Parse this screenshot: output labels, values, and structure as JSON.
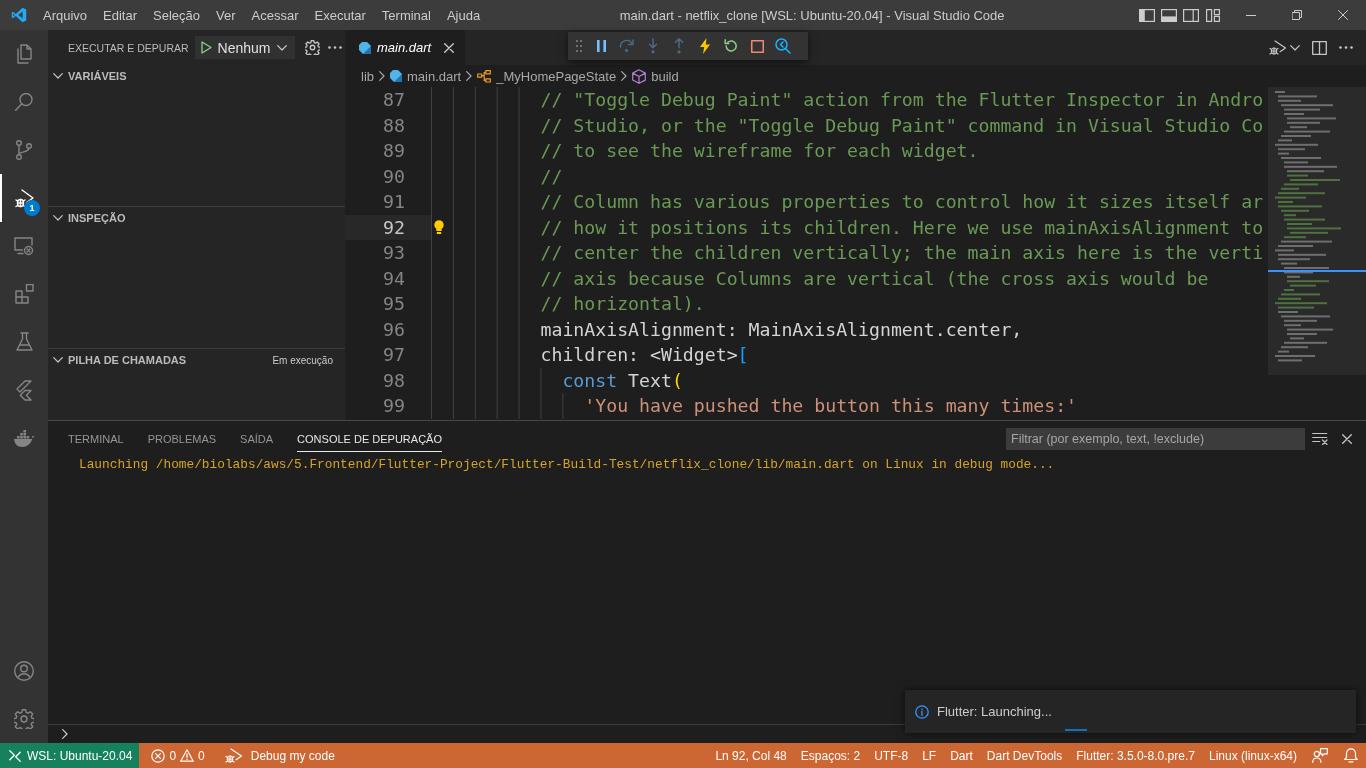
{
  "title_bar": {
    "menu": [
      "Arquivo",
      "Editar",
      "Seleção",
      "Ver",
      "Acessar",
      "Executar",
      "Terminal",
      "Ajuda"
    ],
    "title": "main.dart - netflix_clone [WSL: Ubuntu-20.04] - Visual Studio Code",
    "layout_toggles": [
      {
        "kind": "sidebar",
        "on": true
      },
      {
        "kind": "panel",
        "on": true
      },
      {
        "kind": "auxiliary",
        "on": false
      }
    ]
  },
  "activity_bar": {
    "items": [
      {
        "kind": "explorer",
        "selected": false
      },
      {
        "kind": "search",
        "selected": false
      },
      {
        "kind": "scm",
        "selected": false
      },
      {
        "kind": "debug",
        "selected": true,
        "badge": "1"
      },
      {
        "kind": "remote",
        "selected": false
      },
      {
        "kind": "extensions",
        "selected": false
      },
      {
        "kind": "testing",
        "selected": false
      },
      {
        "kind": "flutter",
        "selected": false
      },
      {
        "kind": "docker",
        "selected": false
      }
    ],
    "bottom": [
      {
        "kind": "accounts"
      },
      {
        "kind": "manage"
      }
    ]
  },
  "sidebar": {
    "title": "EXECUTAR E DEPURAR",
    "launch_config": "Nenhum",
    "sections": [
      {
        "title": "VARIÁVEIS",
        "expanded": true
      },
      {
        "title": "INSPEÇÃO",
        "expanded": true
      },
      {
        "title": "PILHA DE CHAMADAS",
        "expanded": true,
        "status": "Em execução"
      }
    ]
  },
  "debug_toolbar": [
    {
      "kind": "pause",
      "disabled": false
    },
    {
      "kind": "stepover",
      "disabled": true
    },
    {
      "kind": "stepinto",
      "disabled": true
    },
    {
      "kind": "stepout",
      "disabled": true
    },
    {
      "kind": "reload",
      "disabled": false
    },
    {
      "kind": "restart",
      "disabled": false
    },
    {
      "kind": "stop",
      "disabled": false
    },
    {
      "kind": "inspector",
      "disabled": false
    }
  ],
  "editor": {
    "tabs": [
      {
        "label": "main.dart",
        "selected": true,
        "preview": true
      }
    ],
    "breadcrumbs": [
      {
        "kind": "folder",
        "label": "lib"
      },
      {
        "kind": "file",
        "label": "main.dart"
      },
      {
        "kind": "class",
        "label": "_MyHomePageState"
      },
      {
        "kind": "method",
        "label": "build"
      }
    ],
    "lines": [
      {
        "number": "87",
        "current": false,
        "lightbulb": false,
        "tokens": [
          {
            "kind": "comment",
            "text": "// \"Toggle Debug Paint\" action from the Flutter Inspector in Andro"
          }
        ]
      },
      {
        "number": "88",
        "current": false,
        "lightbulb": false,
        "tokens": [
          {
            "kind": "comment",
            "text": "// Studio, or the \"Toggle Debug Paint\" command in Visual Studio Co"
          }
        ]
      },
      {
        "number": "89",
        "current": false,
        "lightbulb": false,
        "tokens": [
          {
            "kind": "comment",
            "text": "// to see the wireframe for each widget."
          }
        ]
      },
      {
        "number": "90",
        "current": false,
        "lightbulb": false,
        "tokens": [
          {
            "kind": "comment",
            "text": "//"
          }
        ]
      },
      {
        "number": "91",
        "current": false,
        "lightbulb": false,
        "tokens": [
          {
            "kind": "comment",
            "text": "// Column has various properties to control how it sizes itself ar"
          }
        ]
      },
      {
        "number": "92",
        "current": true,
        "lightbulb": true,
        "tokens": [
          {
            "kind": "comment",
            "text": "// how it positions its children. Here we use mainAxisAlignment to"
          }
        ]
      },
      {
        "number": "93",
        "current": false,
        "lightbulb": false,
        "tokens": [
          {
            "kind": "comment",
            "text": "// center the children vertically; the main axis here is the verti"
          }
        ]
      },
      {
        "number": "94",
        "current": false,
        "lightbulb": false,
        "tokens": [
          {
            "kind": "comment",
            "text": "// axis because Columns are vertical (the cross axis would be"
          }
        ]
      },
      {
        "number": "95",
        "current": false,
        "lightbulb": false,
        "tokens": [
          {
            "kind": "comment",
            "text": "// horizontal)."
          }
        ]
      },
      {
        "number": "96",
        "current": false,
        "lightbulb": false,
        "tokens": [
          {
            "kind": "plain",
            "text": "mainAxisAlignment: MainAxisAlignment.center,"
          }
        ]
      },
      {
        "number": "97",
        "current": false,
        "lightbulb": false,
        "tokens": [
          {
            "kind": "plain",
            "text": "children: <Widget>"
          },
          {
            "kind": "bracket",
            "text": "["
          }
        ],
        "children": [
          {
            "number": "98",
            "current": false,
            "lightbulb": false,
            "tokens": [
              {
                "kind": "keyword",
                "text": "const"
              },
              {
                "kind": "plain",
                "text": " Text"
              },
              {
                "kind": "paren",
                "text": "("
              }
            ],
            "children": [
              {
                "number": "99",
                "current": false,
                "lightbulb": false,
                "tokens": [
                  {
                    "kind": "string",
                    "text": "'You have pushed the button this many times:'"
                  }
                ]
              }
            ]
          }
        ]
      }
    ]
  },
  "panel": {
    "tabs": [
      {
        "label": "TERMINAL",
        "selected": false
      },
      {
        "label": "PROBLEMAS",
        "selected": false
      },
      {
        "label": "SAÍDA",
        "selected": false
      },
      {
        "label": "CONSOLE DE DEPURAÇÃO",
        "selected": true
      }
    ],
    "filter": {
      "placeholder": "Filtrar (por exemplo, text, !exclude)"
    },
    "output": [
      "Launching /home/biolabs/aws/5.Frontend/Flutter-Project/Flutter-Build-Test/netflix_clone/lib/main.dart on Linux in debug mode..."
    ]
  },
  "notification": {
    "kind": "info",
    "message": "Flutter: Launching...",
    "busy": true
  },
  "status_bar": {
    "debugging": true,
    "remote": "WSL: Ubuntu-20.04",
    "errors": "0",
    "warnings": "0",
    "launch": "Debug my code",
    "items": [
      "Ln 92, Col 48",
      "Espaços: 2",
      "UTF-8",
      "LF",
      "Dart",
      "Dart DevTools",
      "Flutter: 3.5.0-8.0.pre.7",
      "Linux (linux-x64)"
    ]
  }
}
